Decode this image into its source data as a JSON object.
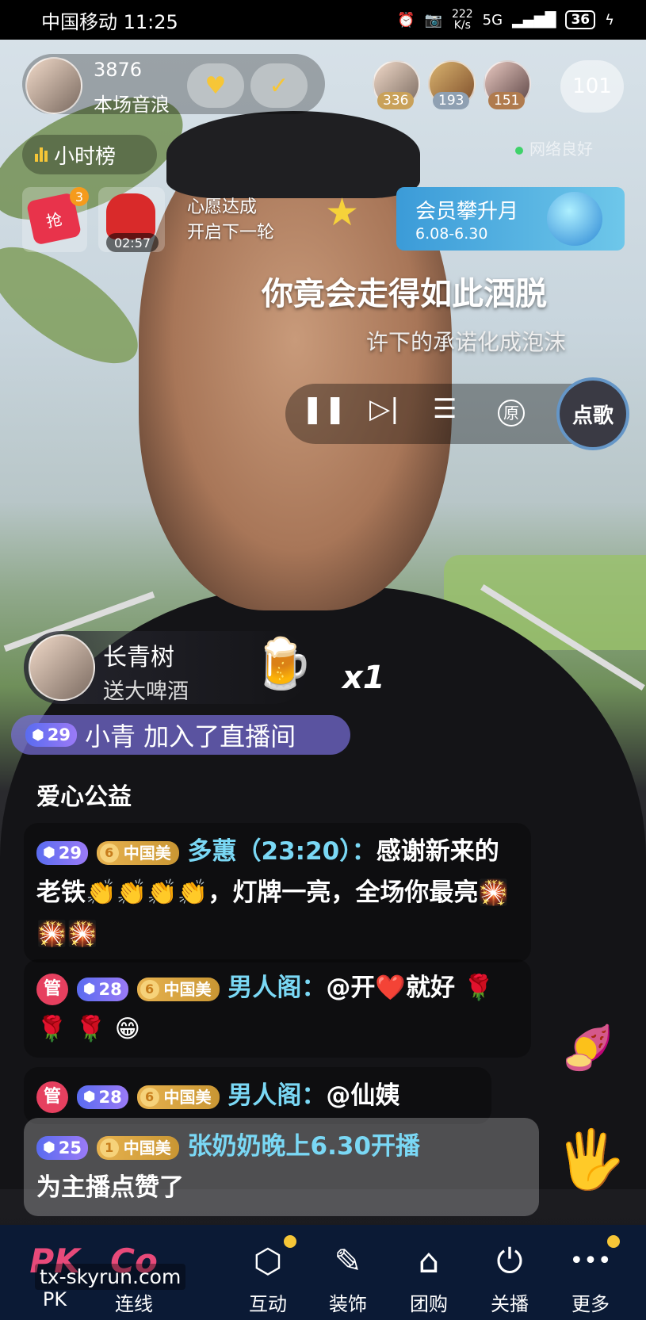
{
  "status_bar": {
    "carrier_time": "中国移动 11:25",
    "net_speed": "222\nK/s",
    "network": "5G",
    "battery": "36"
  },
  "header": {
    "audience_count": "3876",
    "audience_label": "本场音浪",
    "hourly_rank": "小时榜",
    "network_status": "网络良好",
    "online_count": "101",
    "top_fans": [
      {
        "score": "336"
      },
      {
        "score": "193"
      },
      {
        "score": "151"
      }
    ]
  },
  "activities": {
    "redpacket_count": "3",
    "redpacket_icon_text": "抢",
    "timer": "02:57",
    "wish_line1": "心愿达成",
    "wish_line2": "开启下一轮",
    "vip_title": "会员攀升月",
    "vip_date": "6.08-6.30"
  },
  "lyrics": {
    "line1": "你竟会走得如此洒脱",
    "line2": "许下的承诺化成泡沫"
  },
  "player": {
    "song_button": "点歌",
    "original_label": "原"
  },
  "gift": {
    "user": "长青树",
    "desc": "送大啤酒",
    "count": "x1"
  },
  "join": {
    "level": "29",
    "text": "小青 加入了直播间"
  },
  "chat": {
    "section_title": "爱心公益",
    "messages": [
      {
        "level": "29",
        "fan_level": "6",
        "fan_name": "中国美",
        "user": "多蕙（23:20）：",
        "text": "感谢新来的老铁👏👏👏👏，灯牌一亮，全场你最亮🎇🎇🎇"
      },
      {
        "admin": "管",
        "level": "28",
        "fan_level": "6",
        "fan_name": "中国美",
        "user": "男人阁：",
        "text": "@开❤️就好 🌹 🌹 🌹 😁"
      },
      {
        "admin": "管",
        "level": "28",
        "fan_level": "6",
        "fan_name": "中国美",
        "user": "男人阁：",
        "text": "@仙姨"
      },
      {
        "level": "25",
        "fan_level": "1",
        "fan_name": "中国美",
        "user": "张奶奶晚上6.30开播",
        "text": "为主播点赞了"
      }
    ]
  },
  "bottom_nav": {
    "items": [
      {
        "icon": "PK",
        "label": "PK"
      },
      {
        "icon": "Co",
        "label": "连线"
      },
      {
        "icon": "⬡",
        "label": "互动"
      },
      {
        "icon": "✎",
        "label": "装饰"
      },
      {
        "icon": "⌂",
        "label": "团购"
      },
      {
        "icon": "⏻",
        "label": "关播"
      },
      {
        "icon": "•••",
        "label": "更多"
      }
    ],
    "watermark": "tx-skyrun.com"
  },
  "colors": {
    "accent": "#f6c637",
    "join_bg": "#786edc",
    "username": "#7ad8f5",
    "nav_bg": "#0b1a35"
  }
}
